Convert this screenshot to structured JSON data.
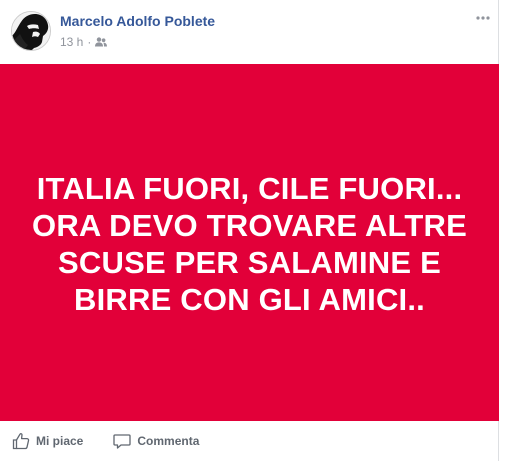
{
  "post": {
    "author": "Marcelo Adolfo Poblete",
    "timestamp": "13 h",
    "separator": "·",
    "audience_icon": "friends-icon",
    "menu_icon": "more-options-icon",
    "banner": {
      "background_color": "#e20039",
      "text_color": "#ffffff",
      "text": "ITALIA FUORI, CILE FUORI...\nORA DEVO TROVARE ALTRE\nSCUSE PER SALAMINE E\nBIRRE CON GLI AMICI.."
    },
    "actions": {
      "like_label": "Mi piace",
      "comment_label": "Commenta"
    }
  }
}
